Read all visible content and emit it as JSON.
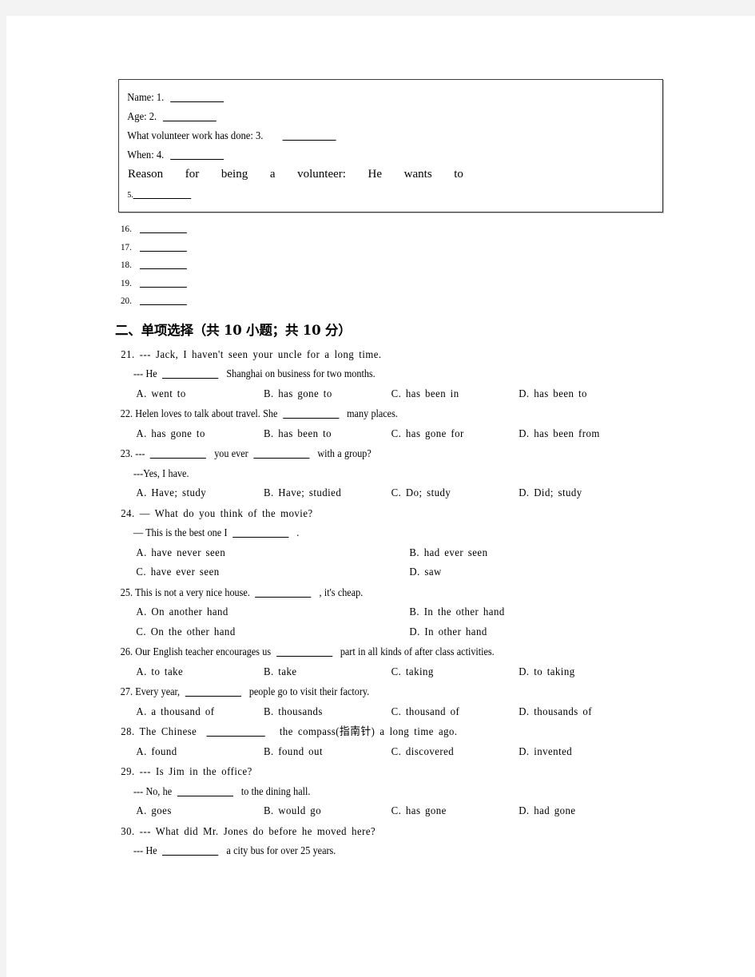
{
  "form_box": {
    "rows": [
      {
        "label": "Name: 1.",
        "blank": "b-md",
        "style": "normal"
      },
      {
        "label": "Age: 2.",
        "blank": "b-md",
        "style": "normal"
      },
      {
        "label": "What volunteer work has done: 3.",
        "blank": "b-md",
        "style": "normal",
        "gap": "wide"
      },
      {
        "label": "When: 4.",
        "blank": "b-md",
        "style": "normal"
      }
    ],
    "reason_words": [
      "Reason",
      "for",
      "being",
      "a",
      "volunteer:",
      "He",
      "wants",
      "to"
    ],
    "reason_blank_label": "5."
  },
  "answer_blanks": [
    {
      "num": "16."
    },
    {
      "num": "17."
    },
    {
      "num": "18."
    },
    {
      "num": "19."
    },
    {
      "num": "20."
    }
  ],
  "section": {
    "heading": "二、单项选择（共 10 小题；共 10 分）"
  },
  "questions": [
    {
      "number": "21.",
      "lines": [
        {
          "type": "stem",
          "text": "21.  ---  Jack, I haven't seen your uncle for a long time.",
          "spacing": "loose"
        },
        {
          "type": "sub",
          "parts": [
            "---  He",
            "BLANK",
            "Shanghai on business for two months."
          ],
          "spacing": "tight"
        }
      ],
      "options": [
        "A. went to",
        "B. has gone to",
        "C. has been in",
        "D. has been to"
      ],
      "option_layout": "four"
    },
    {
      "number": "22.",
      "lines": [
        {
          "type": "stem",
          "parts": [
            "22. Helen loves to talk about travel. She",
            "BLANK",
            "many places."
          ],
          "spacing": "tight"
        }
      ],
      "options": [
        "A. has gone to",
        "B. has been to",
        "C. has gone for",
        "D. has been from"
      ],
      "option_layout": "four"
    },
    {
      "number": "23.",
      "lines": [
        {
          "type": "stem",
          "parts": [
            "23. ---",
            "BLANK",
            "you ever",
            "BLANK",
            "with a group?"
          ],
          "spacing": "tight"
        },
        {
          "type": "sub",
          "text": "---Yes, I have.",
          "spacing": "tight"
        }
      ],
      "options": [
        "A. Have; study",
        "B. Have; studied",
        "C. Do; study",
        "D. Did; study"
      ],
      "option_layout": "four"
    },
    {
      "number": "24.",
      "lines": [
        {
          "type": "stem",
          "text": "24.  —  What do you think of the movie?",
          "spacing": "loose"
        },
        {
          "type": "sub",
          "parts": [
            "—  This is the best one I",
            "BLANK",
            "."
          ],
          "spacing": "tight"
        }
      ],
      "options": [
        "A. have never seen",
        "B. had ever seen",
        "C. have ever seen",
        "D. saw"
      ],
      "option_layout": "two"
    },
    {
      "number": "25.",
      "lines": [
        {
          "type": "stem",
          "parts": [
            "25. This is not a very nice house.",
            "BLANK",
            ", it's cheap."
          ],
          "spacing": "tight"
        }
      ],
      "options": [
        "A. On another hand",
        "B. In the other hand",
        "C. On the other hand",
        "D. In other hand"
      ],
      "option_layout": "two"
    },
    {
      "number": "26.",
      "lines": [
        {
          "type": "stem",
          "parts": [
            "26. Our English teacher encourages us",
            "BLANK",
            "part in all kinds of after class activities."
          ],
          "spacing": "tight"
        }
      ],
      "options": [
        "A. to take",
        "B. take",
        "C. taking",
        "D. to taking"
      ],
      "option_layout": "four"
    },
    {
      "number": "27.",
      "lines": [
        {
          "type": "stem",
          "parts": [
            "27. Every year,",
            "BLANK",
            "people go to visit their factory."
          ],
          "spacing": "tight"
        }
      ],
      "options": [
        "A. a thousand of",
        "B. thousands",
        "C. thousand of",
        "D. thousands of"
      ],
      "option_layout": "four"
    },
    {
      "number": "28.",
      "lines": [
        {
          "type": "stem",
          "parts": [
            "28. The Chinese",
            "BLANK",
            "the compass(指南针) a long time ago."
          ],
          "spacing": "loose"
        }
      ],
      "options": [
        "A. found",
        "B. found out",
        "C. discovered",
        "D. invented"
      ],
      "option_layout": "four"
    },
    {
      "number": "29.",
      "lines": [
        {
          "type": "stem",
          "text": "29.  ---  Is Jim in the office?",
          "spacing": "loose"
        },
        {
          "type": "sub",
          "parts": [
            "---  No, he",
            "BLANK",
            "to the dining hall."
          ],
          "spacing": "tight"
        }
      ],
      "options": [
        "A. goes",
        "B. would go",
        "C. has gone",
        "D. had gone"
      ],
      "option_layout": "four"
    },
    {
      "number": "30.",
      "lines": [
        {
          "type": "stem",
          "text": "30.  ---  What did Mr. Jones do before he moved here?",
          "spacing": "loose"
        },
        {
          "type": "sub",
          "parts": [
            "---  He",
            "BLANK",
            "a city bus for over 25 years."
          ],
          "spacing": "tight"
        }
      ],
      "options": [],
      "option_layout": "none"
    }
  ]
}
